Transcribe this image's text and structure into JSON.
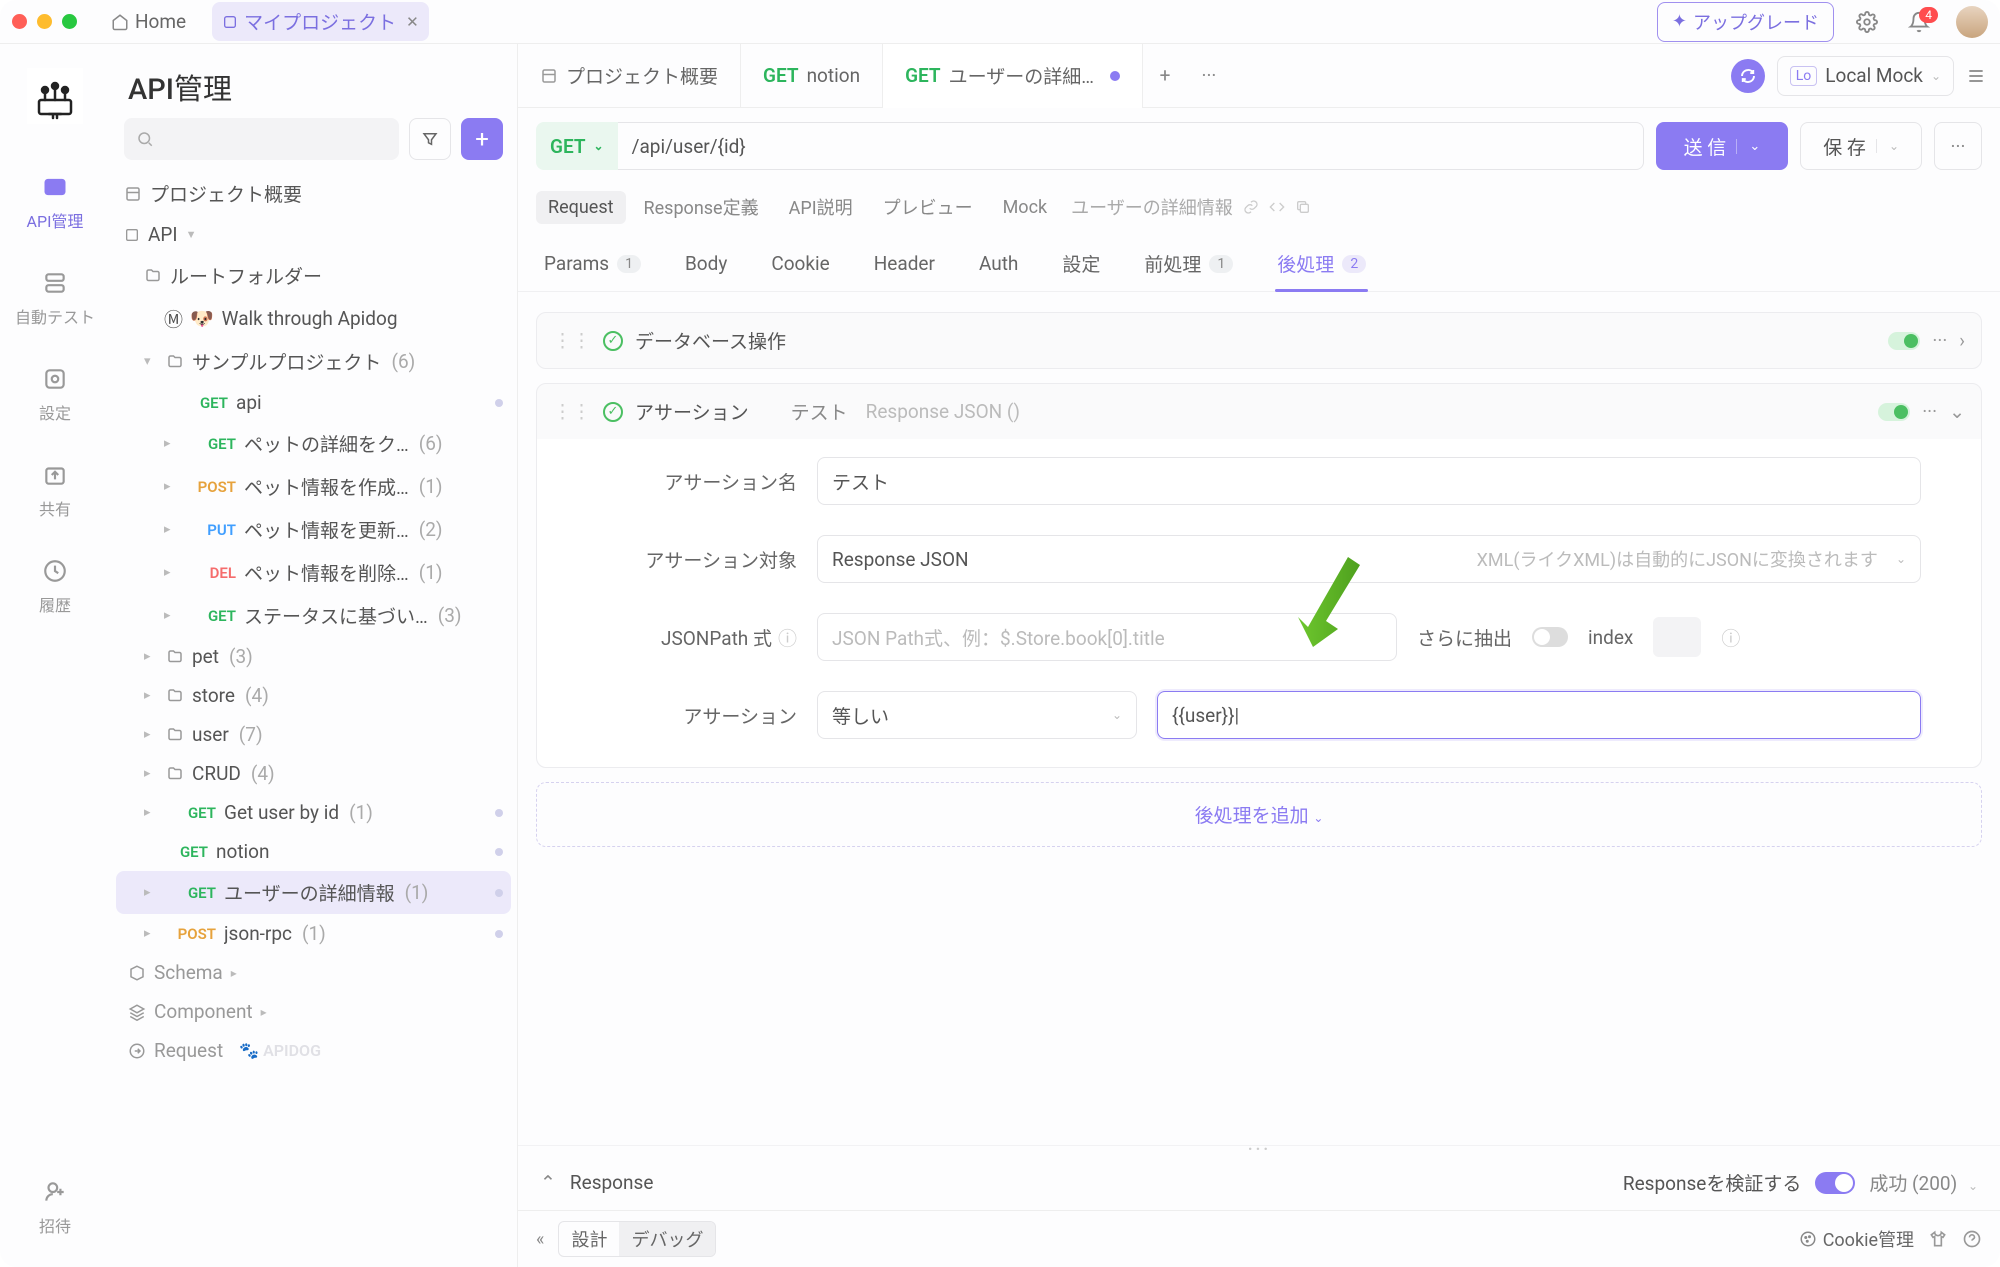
{
  "titlebar": {
    "home": "Home",
    "project": "マイプロジェクト",
    "upgrade": "アップグレード",
    "notif_count": "4"
  },
  "iconbar": {
    "items": [
      {
        "label": "API管理"
      },
      {
        "label": "自動テスト"
      },
      {
        "label": "設定"
      },
      {
        "label": "共有"
      },
      {
        "label": "履歴"
      },
      {
        "label": "招待"
      }
    ]
  },
  "sidebar": {
    "title": "API管理",
    "overview": "プロジェクト概要",
    "api_label": "API",
    "root_folder": "ルートフォルダー",
    "walk": "Walk through Apidog",
    "sample": "サンプルプロジェクト",
    "sample_count": "(6)",
    "items": [
      {
        "method": "GET",
        "label": "api"
      },
      {
        "method": "GET",
        "label": "ペットの詳細をク…",
        "count": "(6)"
      },
      {
        "method": "POST",
        "label": "ペット情報を作成…",
        "count": "(1)"
      },
      {
        "method": "PUT",
        "label": "ペット情報を更新…",
        "count": "(2)"
      },
      {
        "method": "DEL",
        "label": "ペット情報を削除…",
        "count": "(1)"
      },
      {
        "method": "GET",
        "label": "ステータスに基づい…",
        "count": "(3)"
      }
    ],
    "folders": [
      {
        "label": "pet",
        "count": "(3)"
      },
      {
        "label": "store",
        "count": "(4)"
      },
      {
        "label": "user",
        "count": "(7)"
      },
      {
        "label": "CRUD",
        "count": "(4)"
      }
    ],
    "loose": [
      {
        "method": "GET",
        "label": "Get user by id",
        "count": "(1)"
      },
      {
        "method": "GET",
        "label": "notion"
      },
      {
        "method": "GET",
        "label": "ユーザーの詳細情報",
        "count": "(1)"
      },
      {
        "method": "POST",
        "label": "json-rpc",
        "count": "(1)"
      }
    ],
    "schema": "Schema",
    "component": "Component",
    "request": "Request",
    "apidog": "APIDOG"
  },
  "tabs": {
    "t0": "プロジェクト概要",
    "t1_m": "GET",
    "t1": "notion",
    "t2_m": "GET",
    "t2": "ユーザーの詳細…",
    "env_lo": "Lo",
    "env": "Local Mock"
  },
  "req": {
    "method": "GET",
    "url": "/api/user/{id}",
    "send": "送 信",
    "save": "保 存"
  },
  "mini_tabs": {
    "t0": "Request",
    "t1": "Response定義",
    "t2": "API説明",
    "t3": "プレビュー",
    "t4": "Mock",
    "crumb": "ユーザーの詳細情報"
  },
  "req_tabs": {
    "t0": "Params",
    "b0": "1",
    "t1": "Body",
    "t2": "Cookie",
    "t3": "Header",
    "t4": "Auth",
    "t5": "設定",
    "t6": "前処理",
    "b6": "1",
    "t7": "後処理",
    "b7": "2"
  },
  "proc": {
    "p0_title": "データベース操作",
    "p1_title": "アサーション",
    "p1_sub": "テスト",
    "p1_sub2": "Response JSON ()",
    "f_name_label": "アサーション名",
    "f_name_value": "テスト",
    "f_target_label": "アサーション対象",
    "f_target_value": "Response JSON",
    "f_target_hint": "XML(ライクXML)は自動的にJSONに変換されます",
    "f_path_label": "JSONPath 式",
    "f_path_placeholder": "JSON Path式、例：$.Store.book[0].title",
    "f_extract": "さらに抽出",
    "f_index": "index",
    "f_assert_label": "アサーション",
    "f_assert_op": "等しい",
    "f_assert_value": "{{user}}|",
    "add": "後処理を追加"
  },
  "resp": {
    "label": "Response",
    "verify": "Responseを検証する",
    "status": "成功 (200)"
  },
  "bottom": {
    "design": "設計",
    "debug": "デバッグ",
    "cookie": "Cookie管理"
  }
}
